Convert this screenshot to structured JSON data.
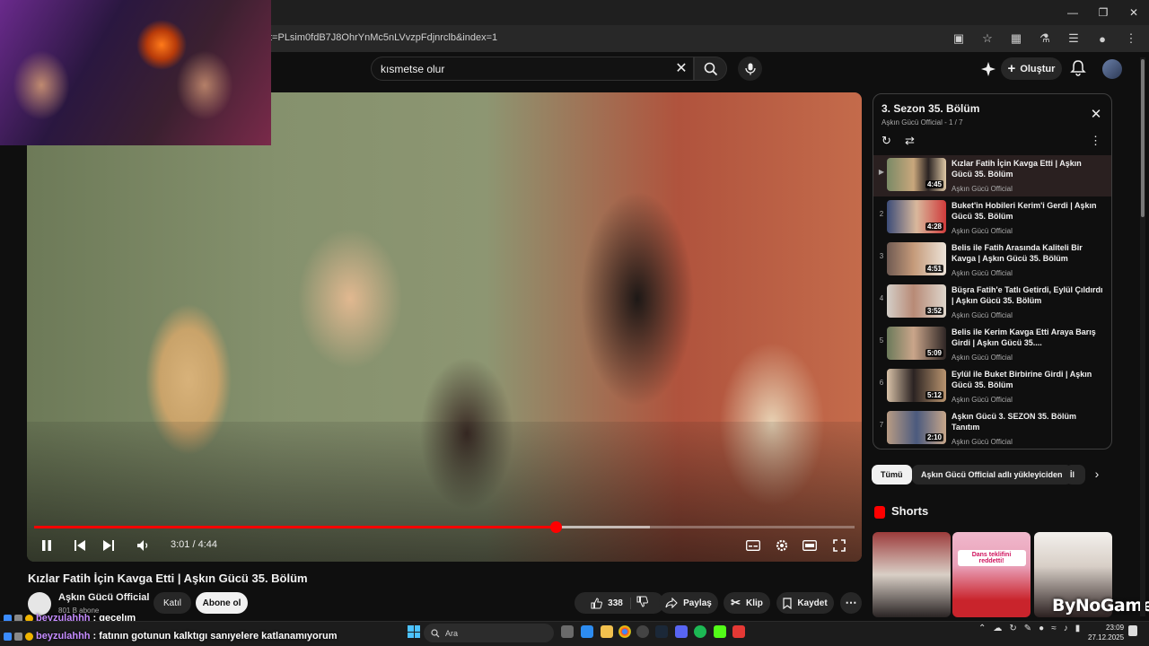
{
  "browser": {
    "url": "t=PLsim0fdB7J8OhrYnMc5nLVvzpFdjnrclb&index=1",
    "window_controls": [
      "minimize",
      "maximize",
      "close"
    ]
  },
  "header": {
    "search_query": "kısmetse olur",
    "create_label": "Oluştur"
  },
  "player": {
    "time_current": "3:01",
    "time_total": "4:44",
    "progress_fraction": 0.636,
    "buffer_fraction": 0.75,
    "accent": "#ff0000"
  },
  "video": {
    "title": "Kızlar Fatih İçin Kavga Etti | Aşkın Gücü 35. Bölüm",
    "channel": "Aşkın Gücü Official",
    "subscribers": "801 B abone",
    "join_label": "Katıl",
    "subscribe_label": "Abone ol",
    "likes": "338",
    "share_label": "Paylaş",
    "clip_label": "Klip",
    "save_label": "Kaydet"
  },
  "playlist": {
    "title": "3. Sezon 35. Bölüm",
    "meta": "Aşkın Gücü Official - 1 / 7",
    "items": [
      {
        "index": "▶",
        "title": "Kızlar Fatih İçin Kavga Etti | Aşkın Gücü 35. Bölüm",
        "duration": "4:45",
        "channel": "Aşkın Gücü Official"
      },
      {
        "index": "2",
        "title": "Buket'in Hobileri Kerim'i Gerdi | Aşkın Gücü 35. Bölüm",
        "duration": "4:28",
        "channel": "Aşkın Gücü Official"
      },
      {
        "index": "3",
        "title": "Belis ile Fatih Arasında Kaliteli Bir Kavga | Aşkın Gücü 35. Bölüm",
        "duration": "4:51",
        "channel": "Aşkın Gücü Official"
      },
      {
        "index": "4",
        "title": "Büşra Fatih'e Tatlı Getirdi, Eylül Çıldırdı | Aşkın Gücü 35. Bölüm",
        "duration": "3:52",
        "channel": "Aşkın Gücü Official"
      },
      {
        "index": "5",
        "title": "Belis ile Kerim Kavga Etti Araya Barış Girdi | Aşkın Gücü 35....",
        "duration": "5:09",
        "channel": "Aşkın Gücü Official"
      },
      {
        "index": "6",
        "title": "Eylül ile Buket Birbirine Girdi | Aşkın Gücü 35. Bölüm",
        "duration": "5:12",
        "channel": "Aşkın Gücü Official"
      },
      {
        "index": "7",
        "title": "Aşkın Gücü 3. SEZON 35. Bölüm Tanıtım",
        "duration": "2:10",
        "channel": "Aşkın Gücü Official"
      }
    ]
  },
  "chips": [
    "Tümü",
    "Aşkın Gücü Official adlı yükleyiciden",
    "İl"
  ],
  "shorts": {
    "label": "Shorts",
    "items": [
      {
        "caption": ""
      },
      {
        "caption": "Dans teklifini reddetti!"
      },
      {
        "caption": ""
      }
    ]
  },
  "overlay": {
    "watermark": "ByNoGame",
    "chat": [
      {
        "user": "beyzulahhh",
        "message": ": gecelım"
      },
      {
        "user": "beyzulahhh",
        "message": ": fatının gotunun kalktıgı sanıyelere katlanamıyorum"
      }
    ]
  },
  "taskbar": {
    "search_placeholder": "Ara",
    "time": "23:09",
    "date": "27.12.2025"
  }
}
